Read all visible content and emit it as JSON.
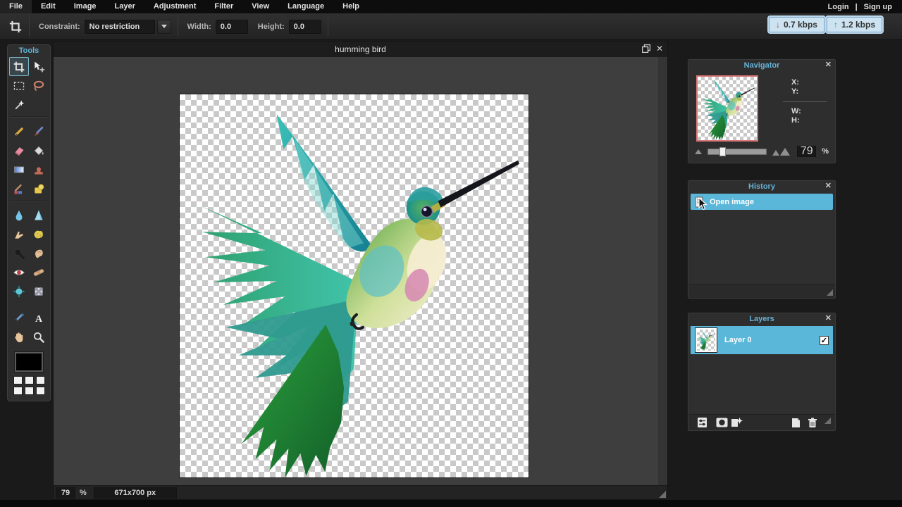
{
  "menu_bar": {
    "items": [
      "File",
      "Edit",
      "Image",
      "Layer",
      "Adjustment",
      "Filter",
      "View",
      "Language",
      "Help"
    ],
    "auth": {
      "login": "Login",
      "divider": "|",
      "signup": "Sign up"
    }
  },
  "options_bar": {
    "active_tool": "crop",
    "constraint_label": "Constraint:",
    "constraint_value": "No restriction",
    "width_label": "Width:",
    "width_value": "0.0",
    "height_label": "Height:",
    "height_value": "0.0",
    "download_rate": "0.7 kbps",
    "upload_rate": "1.2 kbps"
  },
  "tools_panel": {
    "title": "Tools",
    "selected_tool": "crop",
    "foreground_color": "#000000",
    "tool_icons": [
      "crop-icon",
      "move-icon",
      "marquee-icon",
      "lasso-icon",
      "wand-icon",
      "pencil-icon",
      "brush-icon",
      "eraser-icon",
      "bucket-icon",
      "gradient-icon",
      "clone-stamp-icon",
      "color-replace-icon",
      "draw-icon",
      "blur-icon",
      "sharpen-icon",
      "smudge-icon",
      "sponge-icon",
      "dodge-icon",
      "burn-icon",
      "red-eye-icon",
      "heal-icon",
      "bloat-icon",
      "pinch-icon",
      "eyedropper-icon",
      "type-icon",
      "hand-icon",
      "zoom-icon"
    ]
  },
  "canvas_window": {
    "title": "humming bird",
    "zoom_value": "79",
    "zoom_unit": "%",
    "dimensions": "671x700 px"
  },
  "navigator": {
    "title": "Navigator",
    "x_label": "X:",
    "y_label": "Y:",
    "w_label": "W:",
    "h_label": "H:",
    "zoom_value": "79",
    "zoom_unit": "%"
  },
  "history": {
    "title": "History",
    "entries": [
      {
        "label": "Open image"
      }
    ]
  },
  "layers": {
    "title": "Layers",
    "rows": [
      {
        "name": "Layer 0",
        "visible": true
      }
    ]
  },
  "icons": {
    "close": "✕",
    "check": "✓",
    "arrow_down": "↓",
    "arrow_up": "↑",
    "type_glyph": "A"
  },
  "colors": {
    "panel_title": "#66b2d6",
    "selection_highlight": "#5bb7d9",
    "rate_badge_bg": "#cde3f2",
    "download_arrow": "#c0392b",
    "upload_arrow": "#2e9e50",
    "navigator_thumb_border": "#d97878"
  }
}
